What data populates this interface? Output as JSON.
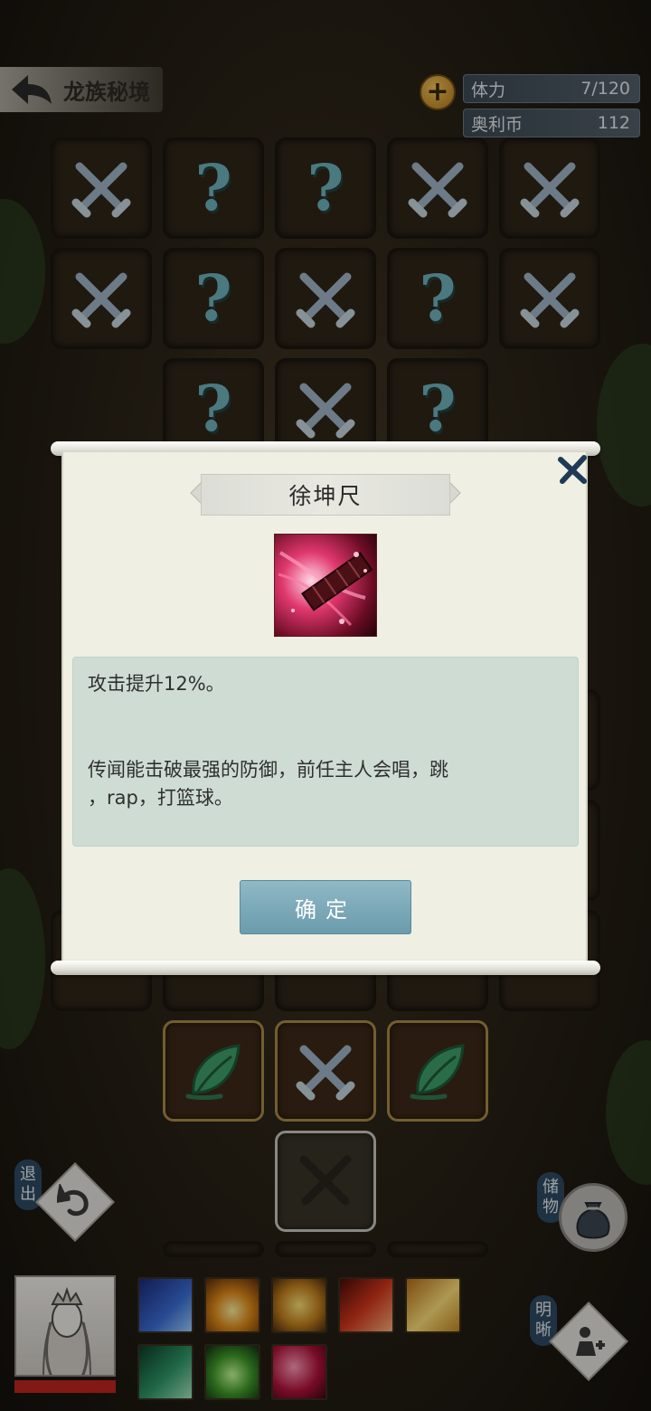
{
  "header": {
    "back_title": "龙族秘境",
    "stamina_label": "体力",
    "stamina_value": "7/120",
    "coin_label": "奥利币",
    "coin_value": "112"
  },
  "side_buttons": {
    "exit_label": "退出",
    "storage_label": "储物",
    "clear_label": "明晰"
  },
  "modal": {
    "item_name": "徐坤尺",
    "effect": "攻击提升12%。",
    "lore_line1": "传闻能击破最强的防御，前任主人会唱，跳",
    "lore_line2": "，rap，打篮球。",
    "confirm_label": "确定"
  },
  "skills": [
    "ice-arrow-skill",
    "flame-burst-skill",
    "gold-coins-skill",
    "crimson-sword-skill",
    "golden-spear-skill",
    "jade-book-skill",
    "green-potion-skill",
    "xukun-ruler-item"
  ],
  "colors": {
    "modal_bg": "#efefe4",
    "desc_bg": "#cfdcd4",
    "confirm_bg": "#6b9bac",
    "question_mark": "#6fb3bd",
    "hp_bar": "#c0251f"
  }
}
